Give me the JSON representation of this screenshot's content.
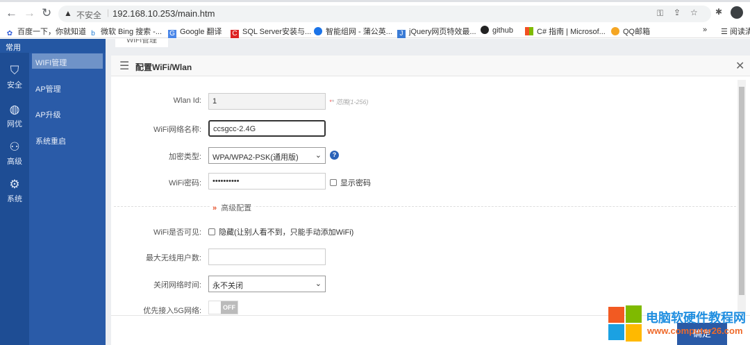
{
  "browser": {
    "url": "192.168.10.253/main.htm",
    "security": "不安全",
    "bookmarks": [
      "百度一下，你就知道",
      "微软 Bing 搜索 -...",
      "Google 翻译",
      "SQL Server安装与...",
      "智能组网 - 蒲公英...",
      "jQuery网页特效最...",
      "github",
      "C# 指南 | Microsof...",
      "QQ邮箱"
    ],
    "more": "»",
    "reading_list": "阅读清单"
  },
  "sidebar": {
    "header": "常用",
    "rail": [
      {
        "label": "安全",
        "icon": "shield-icon"
      },
      {
        "label": "网优",
        "icon": "globe-icon"
      },
      {
        "label": "高级",
        "icon": "user-gear-icon"
      },
      {
        "label": "系统",
        "icon": "gear-icon"
      }
    ],
    "menu": [
      "WIFI管理",
      "AP管理",
      "AP升级",
      "系统重启"
    ]
  },
  "tab": "WiFi管理",
  "panel": {
    "title": "配置WiFi/Wlan",
    "wlan_id": {
      "label": "Wlan Id:",
      "value": "1",
      "hint": "* 范围(1-256)"
    },
    "ssid": {
      "label": "WiFi网络名称:",
      "value": "ccsgcc-2.4G"
    },
    "encryption": {
      "label": "加密类型:",
      "value": "WPA/WPA2-PSK(通用版)"
    },
    "password": {
      "label": "WiFi密码:",
      "value": "••••••••••",
      "show": "显示密码"
    },
    "advanced": "高级配置",
    "visible": {
      "label": "WiFi是否可见:",
      "option": "隐藏(让别人看不到，只能手动添加WiFi)"
    },
    "max_users": {
      "label": "最大无线用户数:",
      "value": ""
    },
    "close_time": {
      "label": "关闭网络时间:",
      "value": "永不关闭"
    },
    "prefer5g": {
      "label": "优先接入5G网络:",
      "state": "OFF"
    },
    "submit": "确定"
  },
  "watermark": {
    "title": "电脑软硬件教程网",
    "url": "www.computer26.com"
  }
}
